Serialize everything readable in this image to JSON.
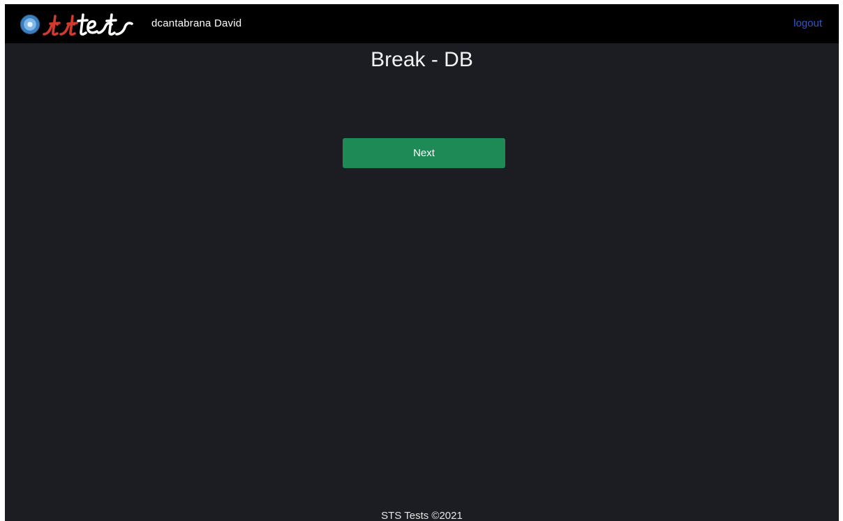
{
  "navbar": {
    "brand": {
      "logo_icon": "sts-disc-logo-icon",
      "wordmark": "ststests",
      "colors": {
        "st_red": "#d23a2e",
        "tests_white": "#ffffff"
      }
    },
    "username": "dcantabrana David",
    "logout_label": "logout"
  },
  "main": {
    "title": "Break - DB",
    "next_label": "Next"
  },
  "footer": {
    "text": "STS Tests ©2021"
  },
  "theme": {
    "background": "#1c1d23",
    "navbar_bg": "#000000",
    "accent_green": "#1e8a55",
    "link_blue": "#2f56c9"
  }
}
